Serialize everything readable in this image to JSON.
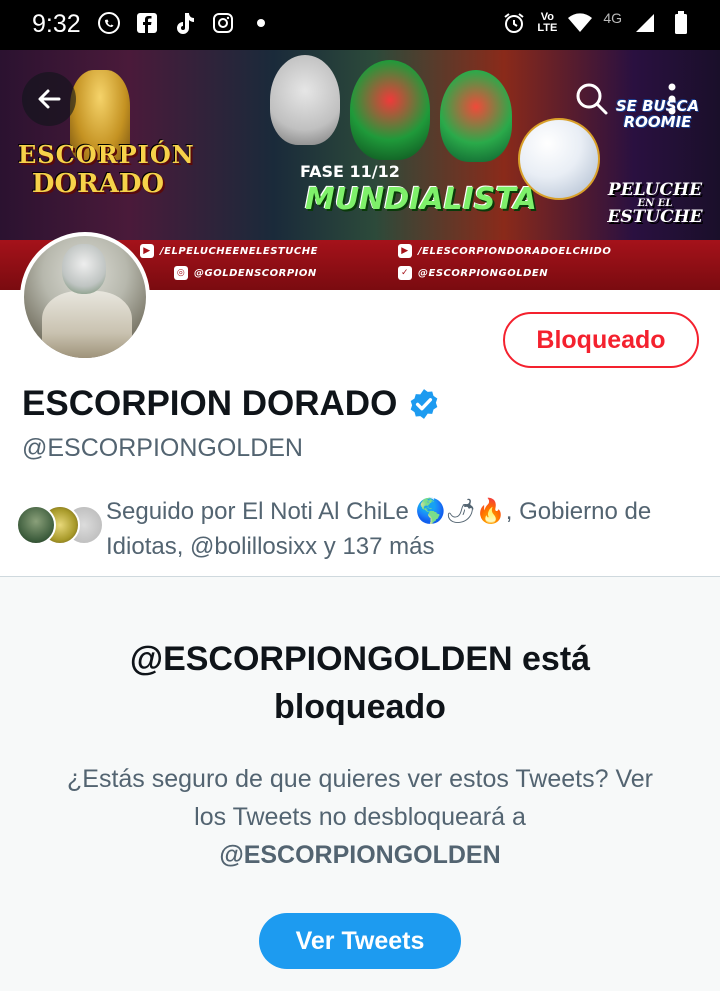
{
  "status_bar": {
    "time": "9:32",
    "left_icons": [
      "whatsapp-icon",
      "facebook-icon",
      "tiktok-icon",
      "instagram-icon",
      "dot-icon"
    ],
    "right_icons": [
      "alarm-icon",
      "volte-icon",
      "wifi-icon",
      "signal-icon",
      "battery-icon"
    ],
    "volte_label": "Vo",
    "lte_label": "LTE",
    "network_label": "4G"
  },
  "banner": {
    "logo_line1": "ESCORPIÓN",
    "logo_line2": "DORADO",
    "fase_text": "FASE 11/12",
    "mundialista_text": "MUNDIALISTA",
    "roomie_line1": "SE BUSCA",
    "roomie_line2": "ROOMIE",
    "peluche_line1": "PELUCHE",
    "peluche_line2": "EN EL",
    "peluche_line3": "ESTUCHE",
    "social_handles": [
      {
        "icon": "youtube-icon",
        "text": "/ELPELUCHEENELESTUCHE"
      },
      {
        "icon": "youtube-icon",
        "text": "/ELESCORPIONDORADOELCHIDO"
      },
      {
        "icon": "instagram-icon",
        "text": "@GOLDENSCORPION"
      },
      {
        "icon": "twitter-icon",
        "text": "@ESCORPIONGOLDEN"
      }
    ]
  },
  "profile": {
    "display_name": "ESCORPION DORADO",
    "handle": "@ESCORPIONGOLDEN",
    "verified": true,
    "block_button_label": "Bloqueado",
    "followed_by_prefix": "Seguido por El Noti Al ChiLe ",
    "followed_by_emojis": "🌎🌶🔥",
    "followed_by_suffix": ", Gobierno de Idiotas, @bolillosixx y 137 más"
  },
  "blocked_notice": {
    "title": "@ESCORPIONGOLDEN está bloqueado",
    "description_prefix": "¿Estás seguro de que quieres ver estos Tweets? Ver los Tweets no desbloqueará a",
    "description_handle": "@ESCORPIONGOLDEN",
    "button_label": "Ver Tweets"
  },
  "colors": {
    "accent": "#1d9bf0",
    "blocked_red": "#f4212e",
    "secondary_text": "#536471",
    "primary_text": "#0f1419",
    "section_bg": "#f7f9f9"
  }
}
